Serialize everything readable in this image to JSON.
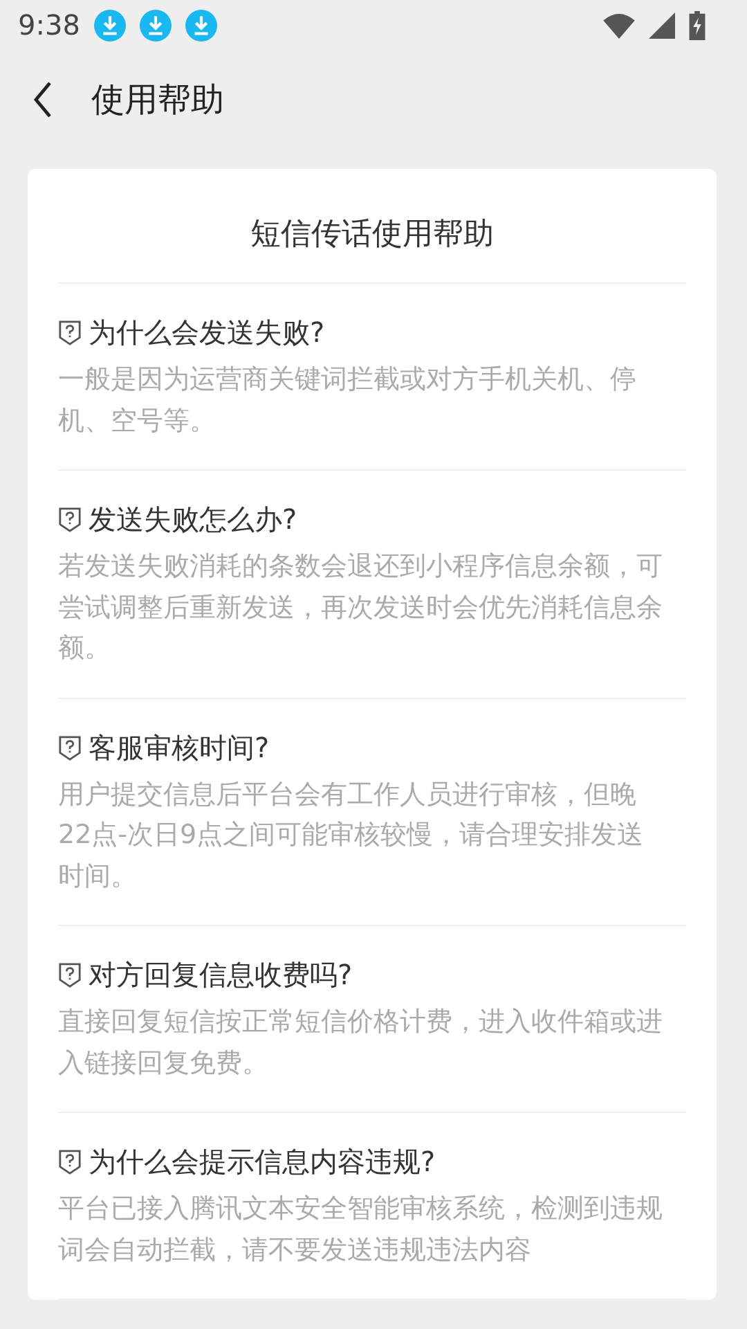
{
  "status_bar": {
    "time": "9:38"
  },
  "header": {
    "title": "使用帮助"
  },
  "card": {
    "title": "短信传话使用帮助",
    "items": [
      {
        "question": "为什么会发送失败?",
        "answer": "一般是因为运营商关键词拦截或对方手机关机、停机、空号等。"
      },
      {
        "question": "发送失败怎么办?",
        "answer": "若发送失败消耗的条数会退还到小程序信息余额，可尝试调整后重新发送，再次发送时会优先消耗信息余额。"
      },
      {
        "question": "客服审核时间?",
        "answer": "用户提交信息后平台会有工作人员进行审核，但晚22点-次日9点之间可能审核较慢，请合理安排发送时间。"
      },
      {
        "question": "对方回复信息收费吗?",
        "answer": "直接回复短信按正常短信价格计费，进入收件箱或进入链接回复免费。"
      },
      {
        "question": "为什么会提示信息内容违规?",
        "answer": "平台已接入腾讯文本安全智能审核系统，检测到违规词会自动拦截，请不要发送违规违法内容"
      }
    ]
  }
}
